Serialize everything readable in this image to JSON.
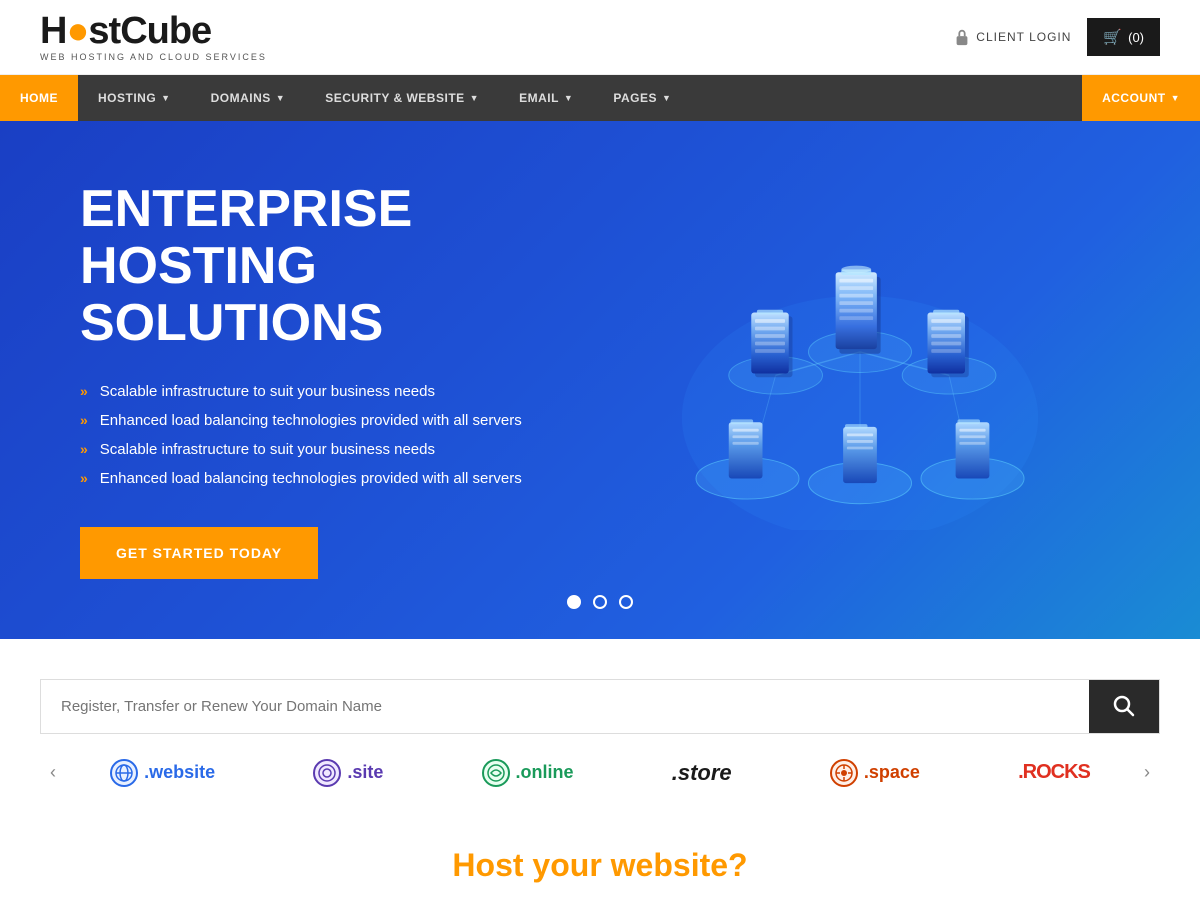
{
  "brand": {
    "name_part1": "H",
    "name_power": "●",
    "name_part2": "stCube",
    "subtitle": "WEB HOSTING AND CLOUD SERVICES"
  },
  "header": {
    "client_login": "CLIENT LOGIN",
    "cart_label": "(0)"
  },
  "nav": {
    "items": [
      {
        "id": "home",
        "label": "HOME",
        "active": true,
        "dropdown": false
      },
      {
        "id": "hosting",
        "label": "HOSTING",
        "active": false,
        "dropdown": true
      },
      {
        "id": "domains",
        "label": "DOMAINS",
        "active": false,
        "dropdown": true
      },
      {
        "id": "security",
        "label": "SECURITY & WEBSITE",
        "active": false,
        "dropdown": true
      },
      {
        "id": "email",
        "label": "EMAIL",
        "active": false,
        "dropdown": true
      },
      {
        "id": "pages",
        "label": "PAGES",
        "active": false,
        "dropdown": true
      },
      {
        "id": "account",
        "label": "ACCOUNT",
        "active": false,
        "dropdown": true,
        "accent": true
      }
    ]
  },
  "hero": {
    "title_line1": "ENTERPRISE HOSTING",
    "title_line2": "SOLUTIONS",
    "bullets": [
      "Scalable infrastructure to suit your business needs",
      "Enhanced load balancing technologies provided with all servers",
      "Scalable infrastructure to suit your business needs",
      "Enhanced load balancing technologies provided with all servers"
    ],
    "cta_label": "GET STARTED TODAY",
    "slides_count": 3
  },
  "domain": {
    "placeholder": "Register, Transfer or Renew Your Domain Name",
    "search_icon": "🔍"
  },
  "tlds": [
    {
      "id": "website",
      "icon": "W",
      "label": ".website",
      "class": "website"
    },
    {
      "id": "site",
      "icon": "S",
      "label": ".site",
      "class": "site"
    },
    {
      "id": "online",
      "icon": "O",
      "label": ".online",
      "class": "online"
    },
    {
      "id": "store",
      "icon": "",
      "label": ".store",
      "class": "store"
    },
    {
      "id": "space",
      "icon": "⊕",
      "label": ".space",
      "class": "space"
    },
    {
      "id": "rocks",
      "icon": "",
      "label": ".ROCKS",
      "class": "rocks"
    }
  ],
  "bottom": {
    "title": "Host your website?"
  }
}
